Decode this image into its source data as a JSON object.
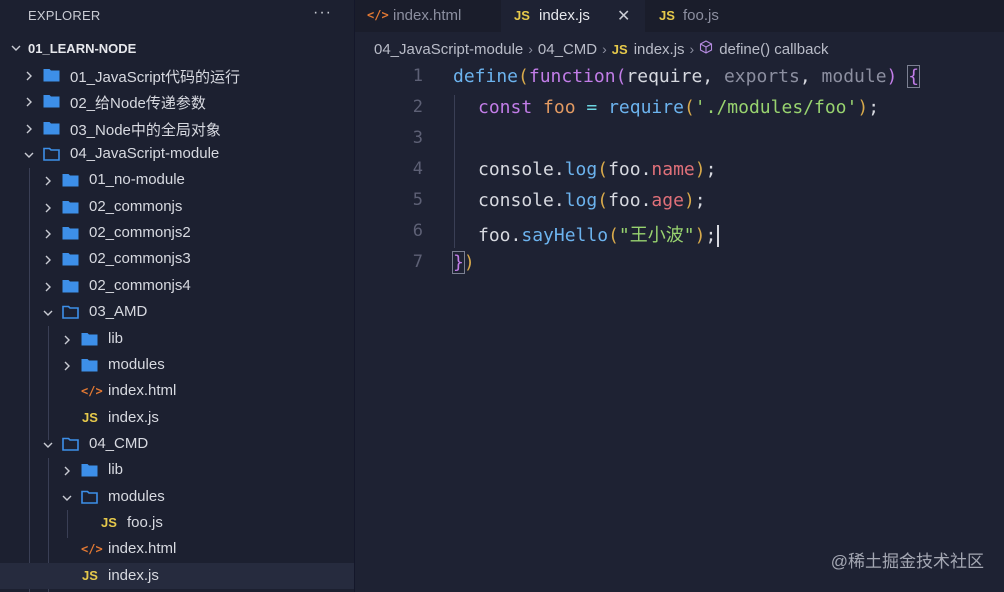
{
  "explorer": {
    "title": "EXPLORER",
    "more": "···",
    "project": "01_LEARN-NODE",
    "items": [
      {
        "label": "01_JavaScript代码的运行"
      },
      {
        "label": "02_给Node传递参数"
      },
      {
        "label": "03_Node中的全局对象"
      },
      {
        "label": "04_JavaScript-module"
      },
      {
        "label": "01_no-module"
      },
      {
        "label": "02_commonjs"
      },
      {
        "label": "02_commonjs2"
      },
      {
        "label": "02_commonjs3"
      },
      {
        "label": "02_commonjs4"
      },
      {
        "label": "03_AMD"
      },
      {
        "label": "lib"
      },
      {
        "label": "modules"
      },
      {
        "label": "index.html"
      },
      {
        "label": "index.js"
      },
      {
        "label": "04_CMD"
      },
      {
        "label": "lib"
      },
      {
        "label": "modules"
      },
      {
        "label": "foo.js"
      },
      {
        "label": "index.html"
      },
      {
        "label": "index.js"
      }
    ]
  },
  "icons": {
    "js": "JS",
    "html": "</>"
  },
  "tabs": [
    {
      "label": "index.html"
    },
    {
      "label": "index.js"
    },
    {
      "label": "foo.js"
    }
  ],
  "breadcrumb": {
    "items": [
      "04_JavaScript-module",
      "04_CMD",
      "index.js",
      "define() callback"
    ]
  },
  "editor": {
    "line_numbers": [
      "1",
      "2",
      "3",
      "4",
      "5",
      "6",
      "7"
    ],
    "code": {
      "l1": {
        "define": "define",
        "open": "(",
        "function": "function",
        "p_open": "(",
        "require": "require",
        "comma1": ",",
        "exports": "exports",
        "comma2": ",",
        "module": "module",
        "p_close": ")",
        "brace": "{"
      },
      "l2": {
        "const": "const",
        "foo": "foo",
        "eq": "=",
        "require": "require",
        "open": "(",
        "str": "'./modules/foo'",
        "close": ")",
        "semi": ";"
      },
      "l4": {
        "console": "console",
        "dot": ".",
        "log": "log",
        "open": "(",
        "foo": "foo",
        "dot2": ".",
        "prop": "name",
        "close": ")",
        "semi": ";"
      },
      "l5": {
        "console": "console",
        "dot": ".",
        "log": "log",
        "open": "(",
        "foo": "foo",
        "dot2": ".",
        "prop": "age",
        "close": ")",
        "semi": ";"
      },
      "l6": {
        "foo": "foo",
        "dot": ".",
        "method": "sayHello",
        "open": "(",
        "str": "\"王小波\"",
        "close": ")",
        "semi": ";"
      },
      "l7": {
        "brace": "}",
        "close": ")"
      }
    }
  },
  "watermark": "@稀土掘金技术社区",
  "colors": {
    "background": "#1e2233",
    "sidebar": "#1c2030",
    "folder": "#3d8fe8",
    "js_icon": "#e6c94b",
    "html_icon": "#e37933"
  }
}
